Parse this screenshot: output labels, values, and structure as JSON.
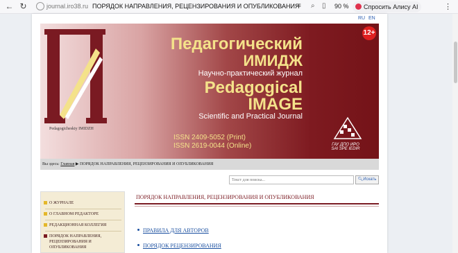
{
  "browser": {
    "domain": "journal.iro38.ru",
    "tab_title": "ПОРЯДОК НАПРАВЛЕНИЯ, РЕЦЕНЗИРОВАНИЯ И ОПУБЛИКОВАНИЯ",
    "zoom": "90 %",
    "alice_label": "Спросить Алису AI"
  },
  "lang": {
    "ru": "RU",
    "en": "EN"
  },
  "banner": {
    "title_ru_1": "Педагогический",
    "title_ru_2": "ИМИДЖ",
    "subtitle_ru": "Научно-практический журнал",
    "title_en_1": "Pedagogical",
    "title_en_2": "IMAGE",
    "subtitle_en": "Scientific and Practical Journal",
    "issn_print": "ISSN 2409-5052 (Print)",
    "issn_online": "ISSN 2619-0044 (Online)",
    "age_rating": "12+",
    "logo_caption": "Pedagogicheskiy IMIDZH",
    "org_ru": "ГАУ ДПО ИРО",
    "org_en": "SAI SPE IEDIR"
  },
  "breadcrumb": {
    "prefix": "Вы здесь:",
    "home": "Главная",
    "current": "▶ ПОРЯДОК НАПРАВЛЕНИЯ, РЕЦЕНЗИРОВАНИЯ И ОПУБЛИКОВАНИЯ"
  },
  "search": {
    "placeholder": "Текст для поиска...",
    "button": "Искать"
  },
  "menu": {
    "items": [
      {
        "label": "О ЖУРНАЛЕ"
      },
      {
        "label": "О ГЛАВНОМ РЕДАКТОРЕ"
      },
      {
        "label": "РЕДАКЦИОННАЯ КОЛЛЕГИЯ"
      },
      {
        "label": "ПОРЯДОК НАПРАВЛЕНИЯ, РЕЦЕНЗИРОВАНИЯ И ОПУБЛИКОВАНИЯ"
      }
    ]
  },
  "content": {
    "title": "ПОРЯДОК НАПРАВЛЕНИЯ, РЕЦЕНЗИРОВАНИЯ И ОПУБЛИКОВАНИЯ",
    "links": [
      {
        "label": "ПРАВИЛА ДЛЯ АВТОРОВ"
      },
      {
        "label": "ПОРЯДОК РЕЦЕНЗИРОВАНИЯ"
      }
    ]
  },
  "colors": {
    "brand_dark": "#7a1a22",
    "brand_gold": "#f4e28a",
    "link": "#1a4fa0"
  }
}
